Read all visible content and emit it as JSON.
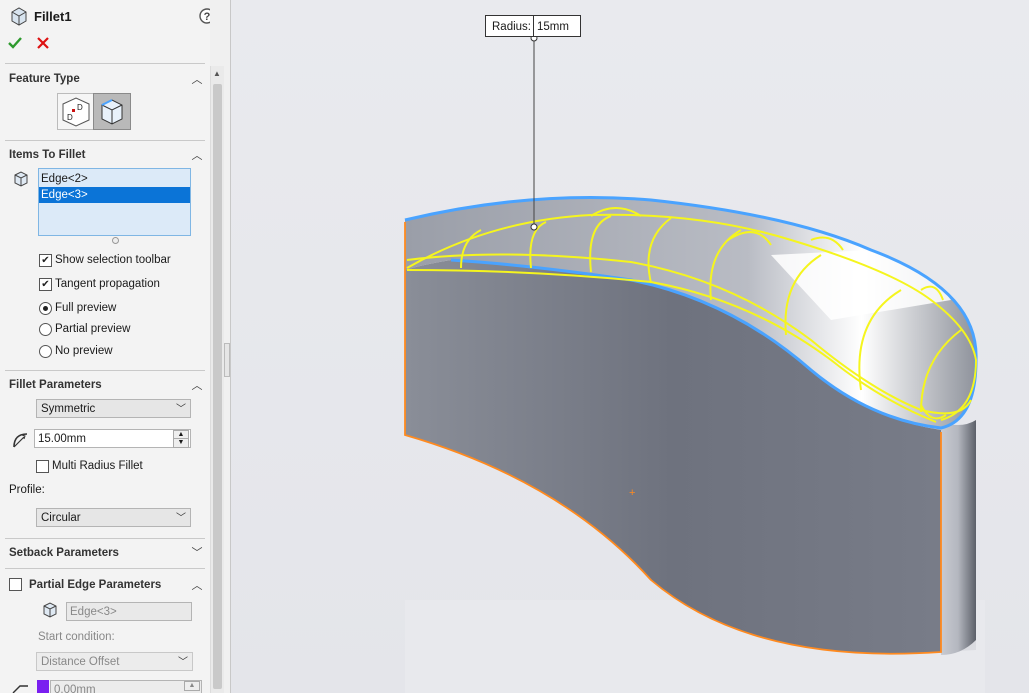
{
  "feature": {
    "title": "Fillet1",
    "ok_icon": "check-icon",
    "cancel_icon": "close-icon",
    "help_icon": "help-icon"
  },
  "sections": {
    "feature_type": {
      "title": "Feature Type",
      "buttons": [
        "manual-fillet-icon",
        "fillet-xpert-icon"
      ]
    },
    "items_to_fillet": {
      "title": "Items To Fillet",
      "items": [
        "Edge<2>",
        "Edge<3>"
      ],
      "selected_index": 1,
      "show_selection_toolbar": {
        "label": "Show selection toolbar",
        "checked": true
      },
      "tangent_propagation": {
        "label": "Tangent propagation",
        "checked": true
      },
      "preview_options": [
        {
          "label": "Full preview",
          "selected": true
        },
        {
          "label": "Partial preview",
          "selected": false
        },
        {
          "label": "No preview",
          "selected": false
        }
      ]
    },
    "fillet_parameters": {
      "title": "Fillet Parameters",
      "method": "Symmetric",
      "radius": "15.00mm",
      "multi_radius": {
        "label": "Multi Radius Fillet",
        "checked": false
      },
      "profile_label": "Profile:",
      "profile": "Circular"
    },
    "setback_parameters": {
      "title": "Setback Parameters"
    },
    "partial_edge_parameters": {
      "title": "Partial Edge Parameters",
      "checked": false,
      "edge": "Edge<3>",
      "start_condition_label": "Start condition:",
      "start_condition": "Distance Offset",
      "offset": "0.00mm"
    }
  },
  "viewport": {
    "callout_label": "Radius:",
    "callout_value": "15mm",
    "colors": {
      "preview": "#f5f51e",
      "selected_edge": "#4aa3ff",
      "highlight_edge": "#ff8a1f"
    }
  }
}
